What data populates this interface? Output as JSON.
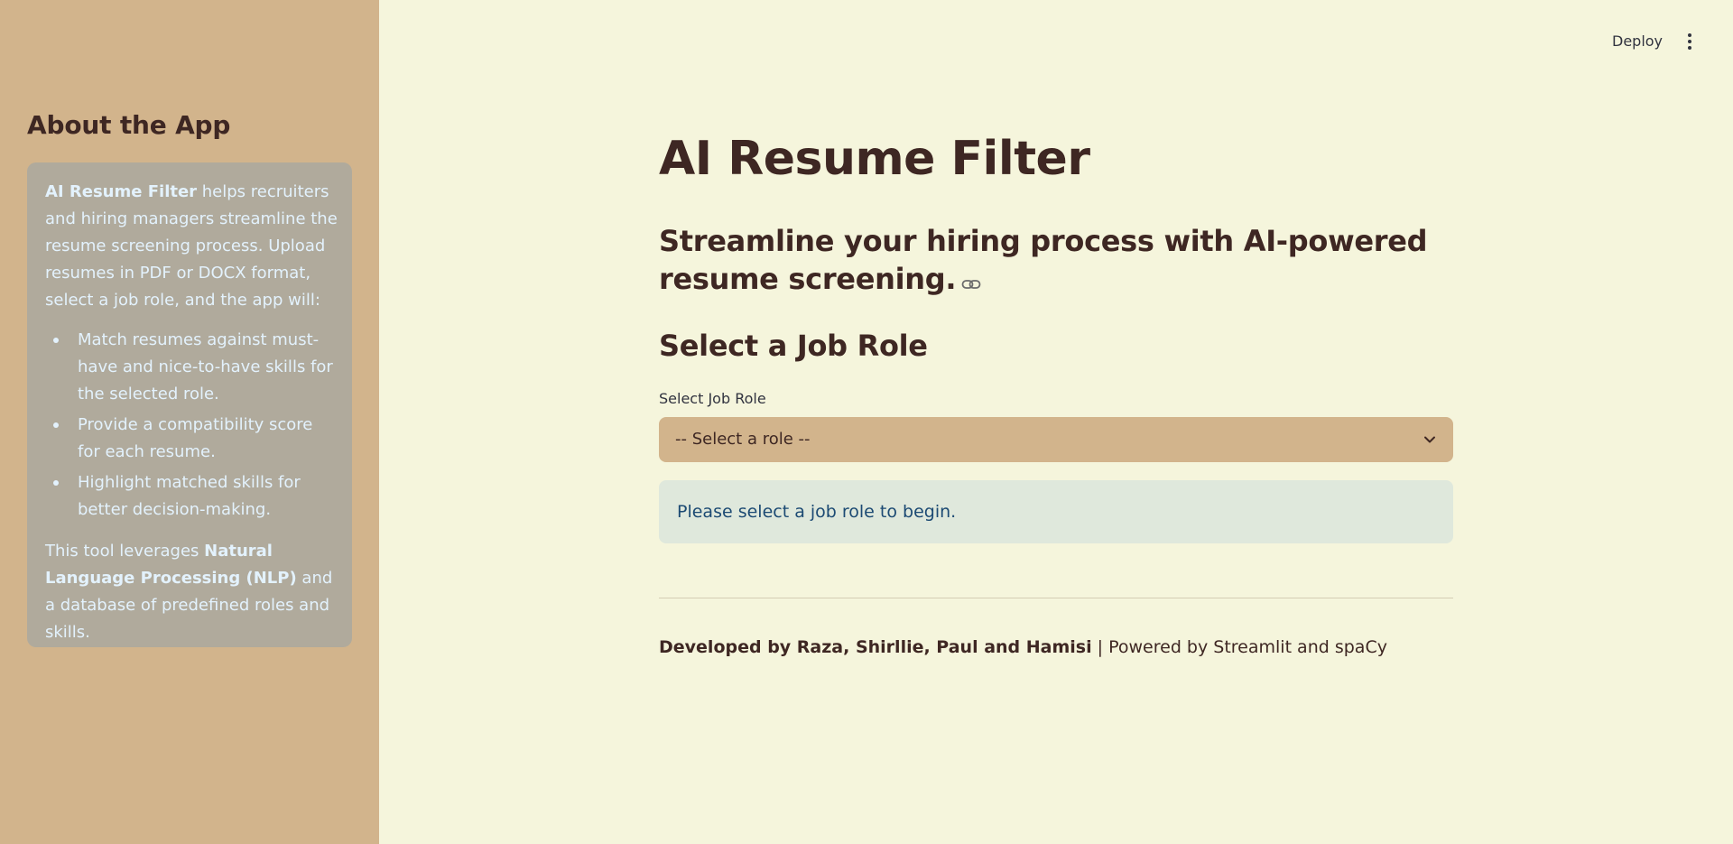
{
  "header": {
    "deploy_label": "Deploy",
    "menu_icon": "more-vertical-icon"
  },
  "sidebar": {
    "heading": "About the App",
    "intro_bold": "AI Resume Filter",
    "intro_text": " helps recruiters and hiring managers streamline the resume screening process. Upload resumes in PDF or DOCX format, select a job role, and the app will:",
    "bullets": [
      "Match resumes against must-have and nice-to-have skills for the selected role.",
      "Provide a compatibility score for each resume.",
      "Highlight matched skills for better decision-making."
    ],
    "closing_pre": "This tool leverages ",
    "closing_bold": "Natural Language Processing (NLP)",
    "closing_post": " and a database of predefined roles and skills."
  },
  "main": {
    "title": "AI Resume Filter",
    "subtitle": "Streamline your hiring process with AI-powered resume screening.",
    "section_heading": "Select a Job Role",
    "select": {
      "label": "Select Job Role",
      "value": "-- Select a role --"
    },
    "info_message": "Please select a job role to begin.",
    "footer_bold": "Developed by Raza, Shirllie, Paul and Hamisi",
    "footer_text": " | Powered by Streamlit and spaCy"
  },
  "colors": {
    "sidebar_bg": "#d2b48c",
    "main_bg": "#f5f5dc",
    "heading_text": "#3e2723",
    "about_box_bg": "#b0aa9c",
    "about_box_text": "#e3f2fd",
    "info_bg": "#dfe8dc",
    "info_text": "#1c4a73"
  }
}
